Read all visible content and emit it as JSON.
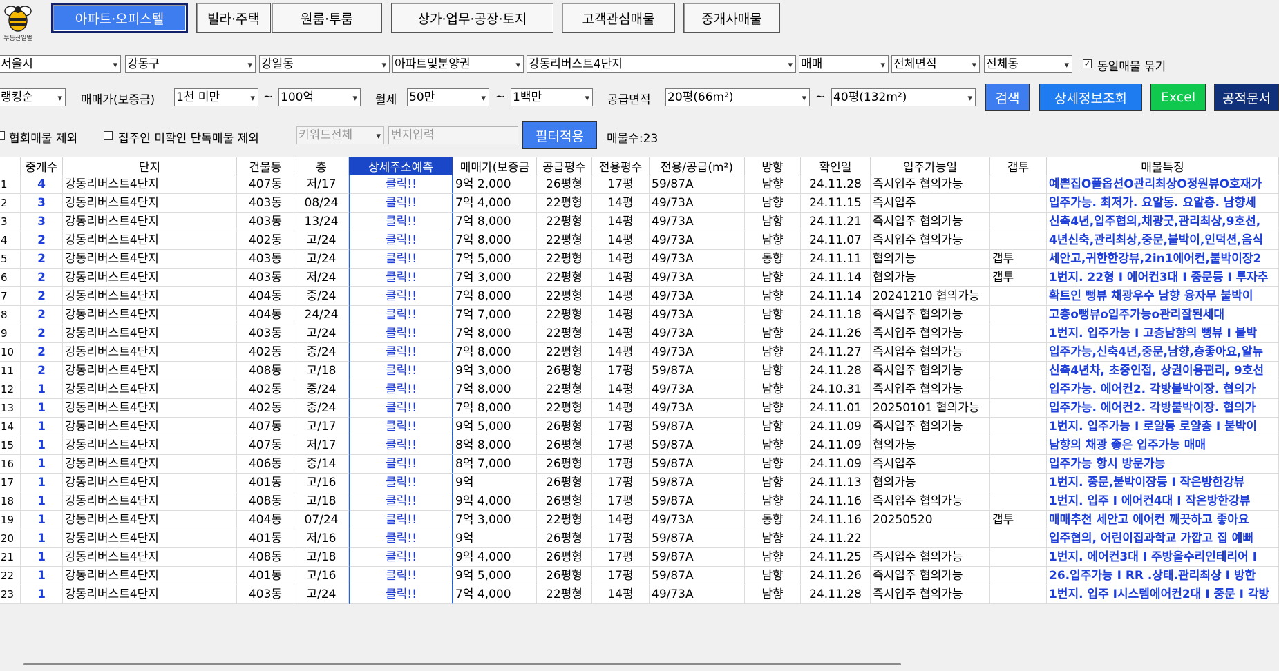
{
  "logo": {
    "text": "부동산일벌"
  },
  "tabs": [
    "아파트·오피스텔",
    "빌라·주택",
    "원룸·투룸",
    "상가·업무·공장·토지",
    "고객관심매물",
    "중개사매물"
  ],
  "filters": {
    "city": "서울시",
    "district": "강동구",
    "dong": "강일동",
    "category": "아파트및분양권",
    "complex": "강동리버스트4단지",
    "deal": "매매",
    "area": "전체면적",
    "building": "전체동",
    "group_label": "동일매물 묶기",
    "group_checked": "✓",
    "sort": "랭킹순",
    "price_label": "매매가(보증금)",
    "price_min": "1천 미만",
    "tilde": "~",
    "price_max": "100억",
    "rent_label": "월세",
    "rent_min": "50만",
    "rent_max": "1백만",
    "supply_label": "공급면적",
    "supply_min": "20평(66m²)",
    "supply_max": "40평(132m²)",
    "exclude_assoc": "협회매물 제외",
    "exclude_unverified": "집주인 미확인 단독매물 제외",
    "keyword": "키워드전체",
    "lot_placeholder": "번지입력",
    "count_label": "매물수:23"
  },
  "buttons": {
    "search": "검색",
    "detail": "상세정보조회",
    "excel": "Excel",
    "docs": "공적문서"
  },
  "colors": {
    "tab_active": "#3d7df0",
    "search": "#3d7df0",
    "detail": "#1e7bf0",
    "excel": "#10c84e",
    "docs": "#10307a",
    "link_blue": "#1d3ed8"
  },
  "columns": [
    "중개수",
    "단지",
    "건물동",
    "층",
    "상세주소예측",
    "매매가(보증금",
    "공급평수",
    "전용평수",
    "전용/공급(m²)",
    "방향",
    "확인일",
    "입주가능일",
    "갭투",
    "매물특징"
  ],
  "rows": [
    [
      "1",
      "4",
      "강동리버스트4단지",
      "407동",
      "저/17",
      "클릭!!",
      "9억 2,000",
      "26평형",
      "17평",
      "59/87A",
      "남향",
      "24.11.28",
      "즉시입주 협의가능",
      "",
      "예쁜집O풀옵션O관리최상O정원뷰O호재가"
    ],
    [
      "2",
      "3",
      "강동리버스트4단지",
      "403동",
      "08/24",
      "클릭!!",
      "7억 4,000",
      "22평형",
      "14평",
      "49/73A",
      "남향",
      "24.11.15",
      "즉시입주",
      "",
      "입주가능. 최저가. 요알동. 요알층. 남향세"
    ],
    [
      "3",
      "3",
      "강동리버스트4단지",
      "403동",
      "13/24",
      "클릭!!",
      "7억 8,000",
      "22평형",
      "14평",
      "49/73A",
      "남향",
      "24.11.21",
      "즉시입주 협의가능",
      "",
      "신축4년,입주협의,채광굿,관리최상,9호선,"
    ],
    [
      "4",
      "2",
      "강동리버스트4단지",
      "402동",
      "고/24",
      "클릭!!",
      "7억 8,000",
      "22평형",
      "14평",
      "49/73A",
      "남향",
      "24.11.07",
      "즉시입주 협의가능",
      "",
      "4년신축,관리최상,중문,붙박이,인덕션,음식"
    ],
    [
      "5",
      "2",
      "강동리버스트4단지",
      "403동",
      "고/24",
      "클릭!!",
      "7억 5,000",
      "22평형",
      "14평",
      "49/73A",
      "동향",
      "24.11.11",
      "협의가능",
      "갭투",
      "세안고,귀한한강뷰,2in1에어컨,붙박이장2"
    ],
    [
      "6",
      "2",
      "강동리버스트4단지",
      "403동",
      "저/24",
      "클릭!!",
      "7억 3,000",
      "22평형",
      "14평",
      "49/73A",
      "남향",
      "24.11.14",
      "협의가능",
      "갭투",
      "1번지. 22형 I 에어컨3대 I 중문등 I 투자추"
    ],
    [
      "7",
      "2",
      "강동리버스트4단지",
      "404동",
      "중/24",
      "클릭!!",
      "7억 8,000",
      "22평형",
      "14평",
      "49/73A",
      "남향",
      "24.11.14",
      "20241210 협의가능",
      "",
      "확트인 뻥뷰 채광우수 남향 융자무 붙박이"
    ],
    [
      "8",
      "2",
      "강동리버스트4단지",
      "404동",
      "24/24",
      "클릭!!",
      "7억 7,000",
      "22평형",
      "14평",
      "49/73A",
      "남향",
      "24.11.18",
      "즉시입주 협의가능",
      "",
      "고층o뻥뷰o입주가능o관리잘된세대"
    ],
    [
      "9",
      "2",
      "강동리버스트4단지",
      "403동",
      "고/24",
      "클릭!!",
      "7억 8,000",
      "22평형",
      "14평",
      "49/73A",
      "남향",
      "24.11.26",
      "즉시입주 협의가능",
      "",
      "1번지. 입주가능 I 고층남향의 뻥뷰 I 붙박"
    ],
    [
      "10",
      "2",
      "강동리버스트4단지",
      "402동",
      "중/24",
      "클릭!!",
      "7억 8,000",
      "22평형",
      "14평",
      "49/73A",
      "남향",
      "24.11.27",
      "즉시입주 협의가능",
      "",
      "입주가능,신축4년,중문,남향,층좋아요,알뉴"
    ],
    [
      "11",
      "2",
      "강동리버스트4단지",
      "408동",
      "고/18",
      "클릭!!",
      "9억 3,000",
      "26평형",
      "17평",
      "59/87A",
      "남향",
      "24.11.28",
      "즉시입주 협의가능",
      "",
      "신축4년차, 초중인접, 상권이용편리, 9호선"
    ],
    [
      "12",
      "1",
      "강동리버스트4단지",
      "402동",
      "중/24",
      "클릭!!",
      "7억 8,000",
      "22평형",
      "14평",
      "49/73A",
      "남향",
      "24.10.31",
      "즉시입주 협의가능",
      "",
      "입주가능. 에어컨2. 각방붙박이장. 협의가"
    ],
    [
      "13",
      "1",
      "강동리버스트4단지",
      "402동",
      "중/24",
      "클릭!!",
      "7억 8,000",
      "22평형",
      "14평",
      "49/73A",
      "남향",
      "24.11.01",
      "20250101 협의가능",
      "",
      "입주가능. 에어컨2. 각방붙박이장. 협의가"
    ],
    [
      "14",
      "1",
      "강동리버스트4단지",
      "407동",
      "고/17",
      "클릭!!",
      "9억 5,000",
      "26평형",
      "17평",
      "59/87A",
      "남향",
      "24.11.09",
      "즉시입주 협의가능",
      "",
      "1번지. 입주가능 I 로얄동 로얄층 I 붙박이"
    ],
    [
      "15",
      "1",
      "강동리버스트4단지",
      "407동",
      "저/17",
      "클릭!!",
      "8억 8,000",
      "26평형",
      "17평",
      "59/87A",
      "남향",
      "24.11.09",
      "협의가능",
      "",
      "남향의 채광 좋은 입주가능 매매"
    ],
    [
      "16",
      "1",
      "강동리버스트4단지",
      "406동",
      "중/14",
      "클릭!!",
      "8억 7,000",
      "26평형",
      "17평",
      "59/87A",
      "남향",
      "24.11.09",
      "즉시입주",
      "",
      "입주가능 항시 방문가능"
    ],
    [
      "17",
      "1",
      "강동리버스트4단지",
      "401동",
      "고/16",
      "클릭!!",
      "9억",
      "26평형",
      "17평",
      "59/87A",
      "남향",
      "24.11.13",
      "협의가능",
      "",
      "1번지. 중문,붙박이장등 I 작은방한강뷰"
    ],
    [
      "18",
      "1",
      "강동리버스트4단지",
      "408동",
      "고/18",
      "클릭!!",
      "9억 4,000",
      "26평형",
      "17평",
      "59/87A",
      "남향",
      "24.11.16",
      "즉시입주 협의가능",
      "",
      "1번지. 입주 I 에어컨4대 I 작은방한강뷰"
    ],
    [
      "19",
      "1",
      "강동리버스트4단지",
      "404동",
      "07/24",
      "클릭!!",
      "7억 3,000",
      "22평형",
      "14평",
      "49/73A",
      "동향",
      "24.11.16",
      "20250520",
      "갭투",
      "매매추천 세안고 에어컨 깨끗하고 좋아요"
    ],
    [
      "20",
      "1",
      "강동리버스트4단지",
      "401동",
      "저/16",
      "클릭!!",
      "9억",
      "26평형",
      "17평",
      "59/87A",
      "남향",
      "24.11.22",
      "",
      "",
      "입주협의, 어린이집과학교 가깝고 집 예뻐"
    ],
    [
      "21",
      "1",
      "강동리버스트4단지",
      "408동",
      "고/18",
      "클릭!!",
      "9억 4,000",
      "26평형",
      "17평",
      "59/87A",
      "남향",
      "24.11.25",
      "즉시입주 협의가능",
      "",
      "1번지. 에어컨3대 I 주방올수리인테리어 I"
    ],
    [
      "22",
      "1",
      "강동리버스트4단지",
      "401동",
      "고/16",
      "클릭!!",
      "9억 5,000",
      "26평형",
      "17평",
      "59/87A",
      "남향",
      "24.11.26",
      "즉시입주 협의가능",
      "",
      "26.입주가능 I  RR .상태.관리최상 I 방한"
    ],
    [
      "23",
      "1",
      "강동리버스트4단지",
      "403동",
      "고/24",
      "클릭!!",
      "7억 4,000",
      "22평형",
      "14평",
      "49/73A",
      "남향",
      "24.11.28",
      "즉시입주 협의가능",
      "",
      "1번지. 입주 I시스템에어컨2대 I 중문 I 각방"
    ]
  ]
}
